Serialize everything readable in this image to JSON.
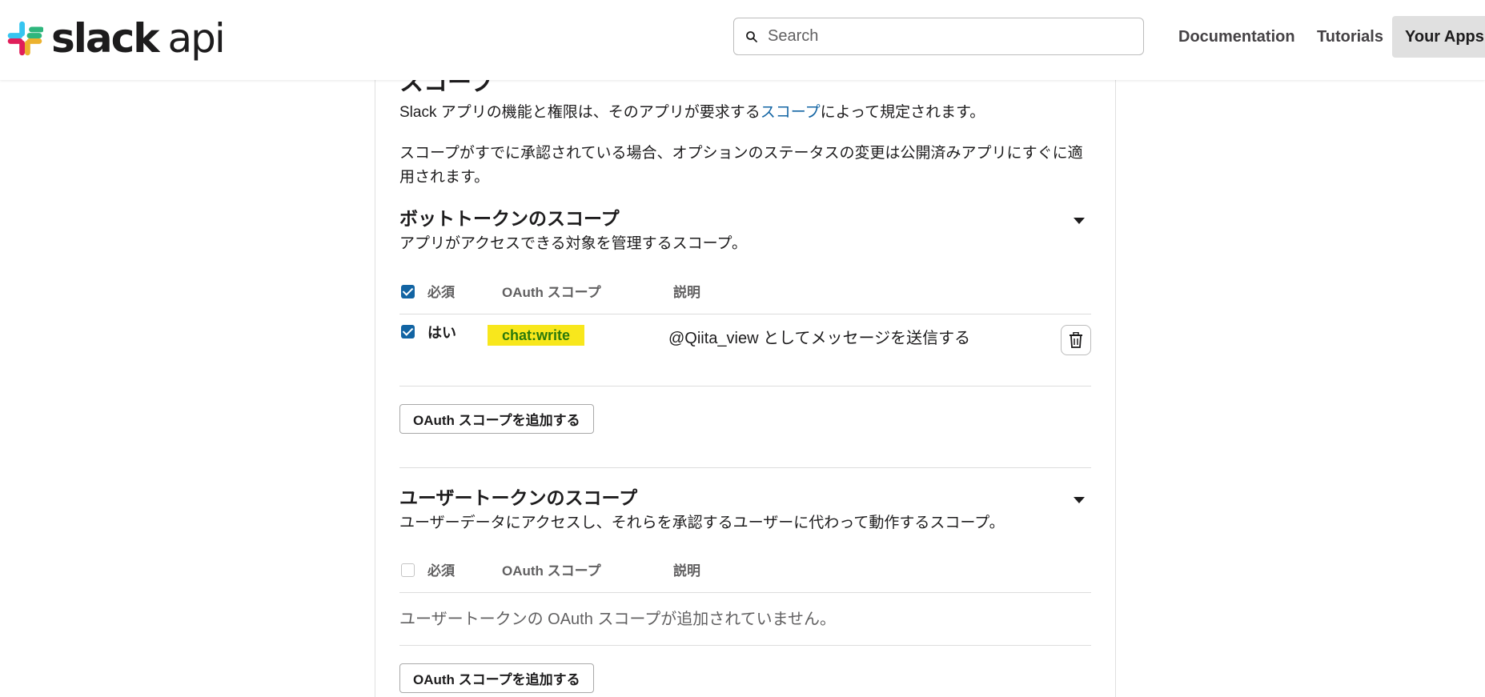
{
  "header": {
    "logo_text_bold": "slack",
    "logo_text_light": "api",
    "search": {
      "placeholder": "Search"
    },
    "nav": {
      "documentation": "Documentation",
      "tutorials": "Tutorials",
      "your_apps": "Your Apps"
    }
  },
  "scopes": {
    "title": "スコープ",
    "intro_before_link": "Slack アプリの機能と権限は、そのアプリが要求する",
    "intro_link": "スコープ",
    "intro_after_link": "によって規定されます。",
    "note": "スコープがすでに承認されている場合、オプションのステータスの変更は公開済みアプリにすぐに適用されます。"
  },
  "bot_section": {
    "title": "ボットトークンのスコープ",
    "subtitle": "アプリがアクセスできる対象を管理するスコープ。",
    "columns": {
      "required": "必須",
      "scope": "OAuth スコープ",
      "description": "説明"
    },
    "header_checked": true,
    "rows": [
      {
        "checked": true,
        "required": "はい",
        "scope": "chat:write",
        "description": "@Qiita_view としてメッセージを送信する"
      }
    ],
    "add_button": "OAuth スコープを追加する"
  },
  "user_section": {
    "title": "ユーザートークンのスコープ",
    "subtitle": "ユーザーデータにアクセスし、それらを承認するユーザーに代わって動作するスコープ。",
    "columns": {
      "required": "必須",
      "scope": "OAuth スコープ",
      "description": "説明"
    },
    "header_checked": false,
    "empty_message": "ユーザートークンの OAuth スコープが追加されていません。",
    "add_button": "OAuth スコープを追加する"
  },
  "colors": {
    "accent_blue": "#1264a3",
    "scope_highlight": "#f8e71c",
    "scope_text": "#2b7a0b"
  }
}
